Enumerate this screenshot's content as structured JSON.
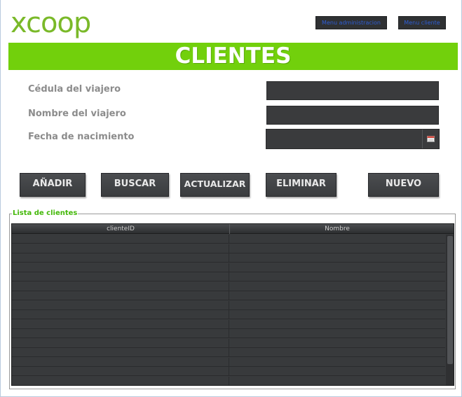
{
  "header": {
    "logo_text": "xcoop",
    "menu_admin_label": "Menu administracion",
    "menu_client_label": "Menu cliente"
  },
  "banner": {
    "title": "CLIENTES"
  },
  "form": {
    "cedula_label": "Cédula del viajero",
    "cedula_value": "",
    "nombre_label": "Nombre del viajero",
    "nombre_value": "",
    "fecha_label": "Fecha de nacimiento",
    "fecha_value": ""
  },
  "actions": {
    "anadir": "AÑADIR",
    "buscar": "BUSCAR",
    "actualizar": "ACTUALIZAR",
    "eliminar": "ELIMINAR",
    "nuevo": "NUEVO"
  },
  "list": {
    "legend": "Lista de clientes",
    "columns": [
      "clienteID",
      "Nombre"
    ],
    "rows": [
      [
        "",
        ""
      ],
      [
        "",
        ""
      ],
      [
        "",
        ""
      ],
      [
        "",
        ""
      ],
      [
        "",
        ""
      ],
      [
        "",
        ""
      ],
      [
        "",
        ""
      ],
      [
        "",
        ""
      ],
      [
        "",
        ""
      ],
      [
        "",
        ""
      ],
      [
        "",
        ""
      ],
      [
        "",
        ""
      ],
      [
        "",
        ""
      ],
      [
        "",
        ""
      ],
      [
        "",
        ""
      ],
      [
        "",
        ""
      ]
    ]
  },
  "colors": {
    "brand_green": "#72d00c",
    "logo_green": "#7ab929",
    "legend_green": "#44b80a",
    "dark_control": "#3a3b3d"
  }
}
